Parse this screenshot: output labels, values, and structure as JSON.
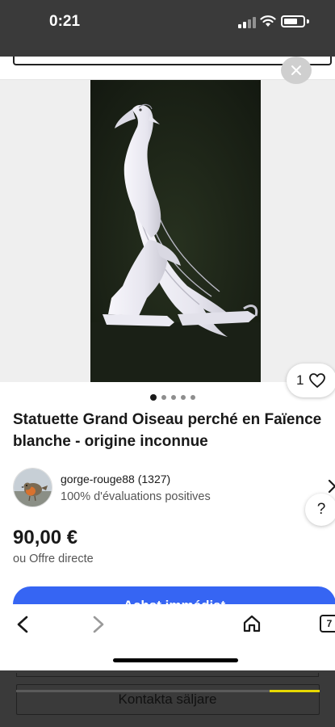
{
  "status_bar": {
    "time": "0:21",
    "icons": [
      "cellular-signal-icon",
      "wifi-icon",
      "battery-icon"
    ]
  },
  "listing": {
    "image_alt": "Statuette d'oiseau blanc en faïence",
    "image_count": 5,
    "image_index": 1,
    "like_count": "1",
    "title": "Statuette Grand Oiseau perché en Faïence blanche - origine inconnue",
    "seller": {
      "name": "gorge-rouge88 (1327)",
      "feedback": "100% d'évaluations positives"
    },
    "price": "90,00 €",
    "offer": "ou Offre directe",
    "buy_button_label": "Achat immédiat"
  },
  "bottom_nav": {
    "tab_count": "7",
    "icons": [
      "back-arrow-icon",
      "forward-arrow-icon",
      "home-icon",
      "tabs-icon"
    ]
  },
  "background_app": {
    "contact_label": "Kontakta säljare"
  },
  "colors": {
    "primary_button": "#3665f3",
    "progress_accent": "#e6d800",
    "text": "#191919"
  }
}
